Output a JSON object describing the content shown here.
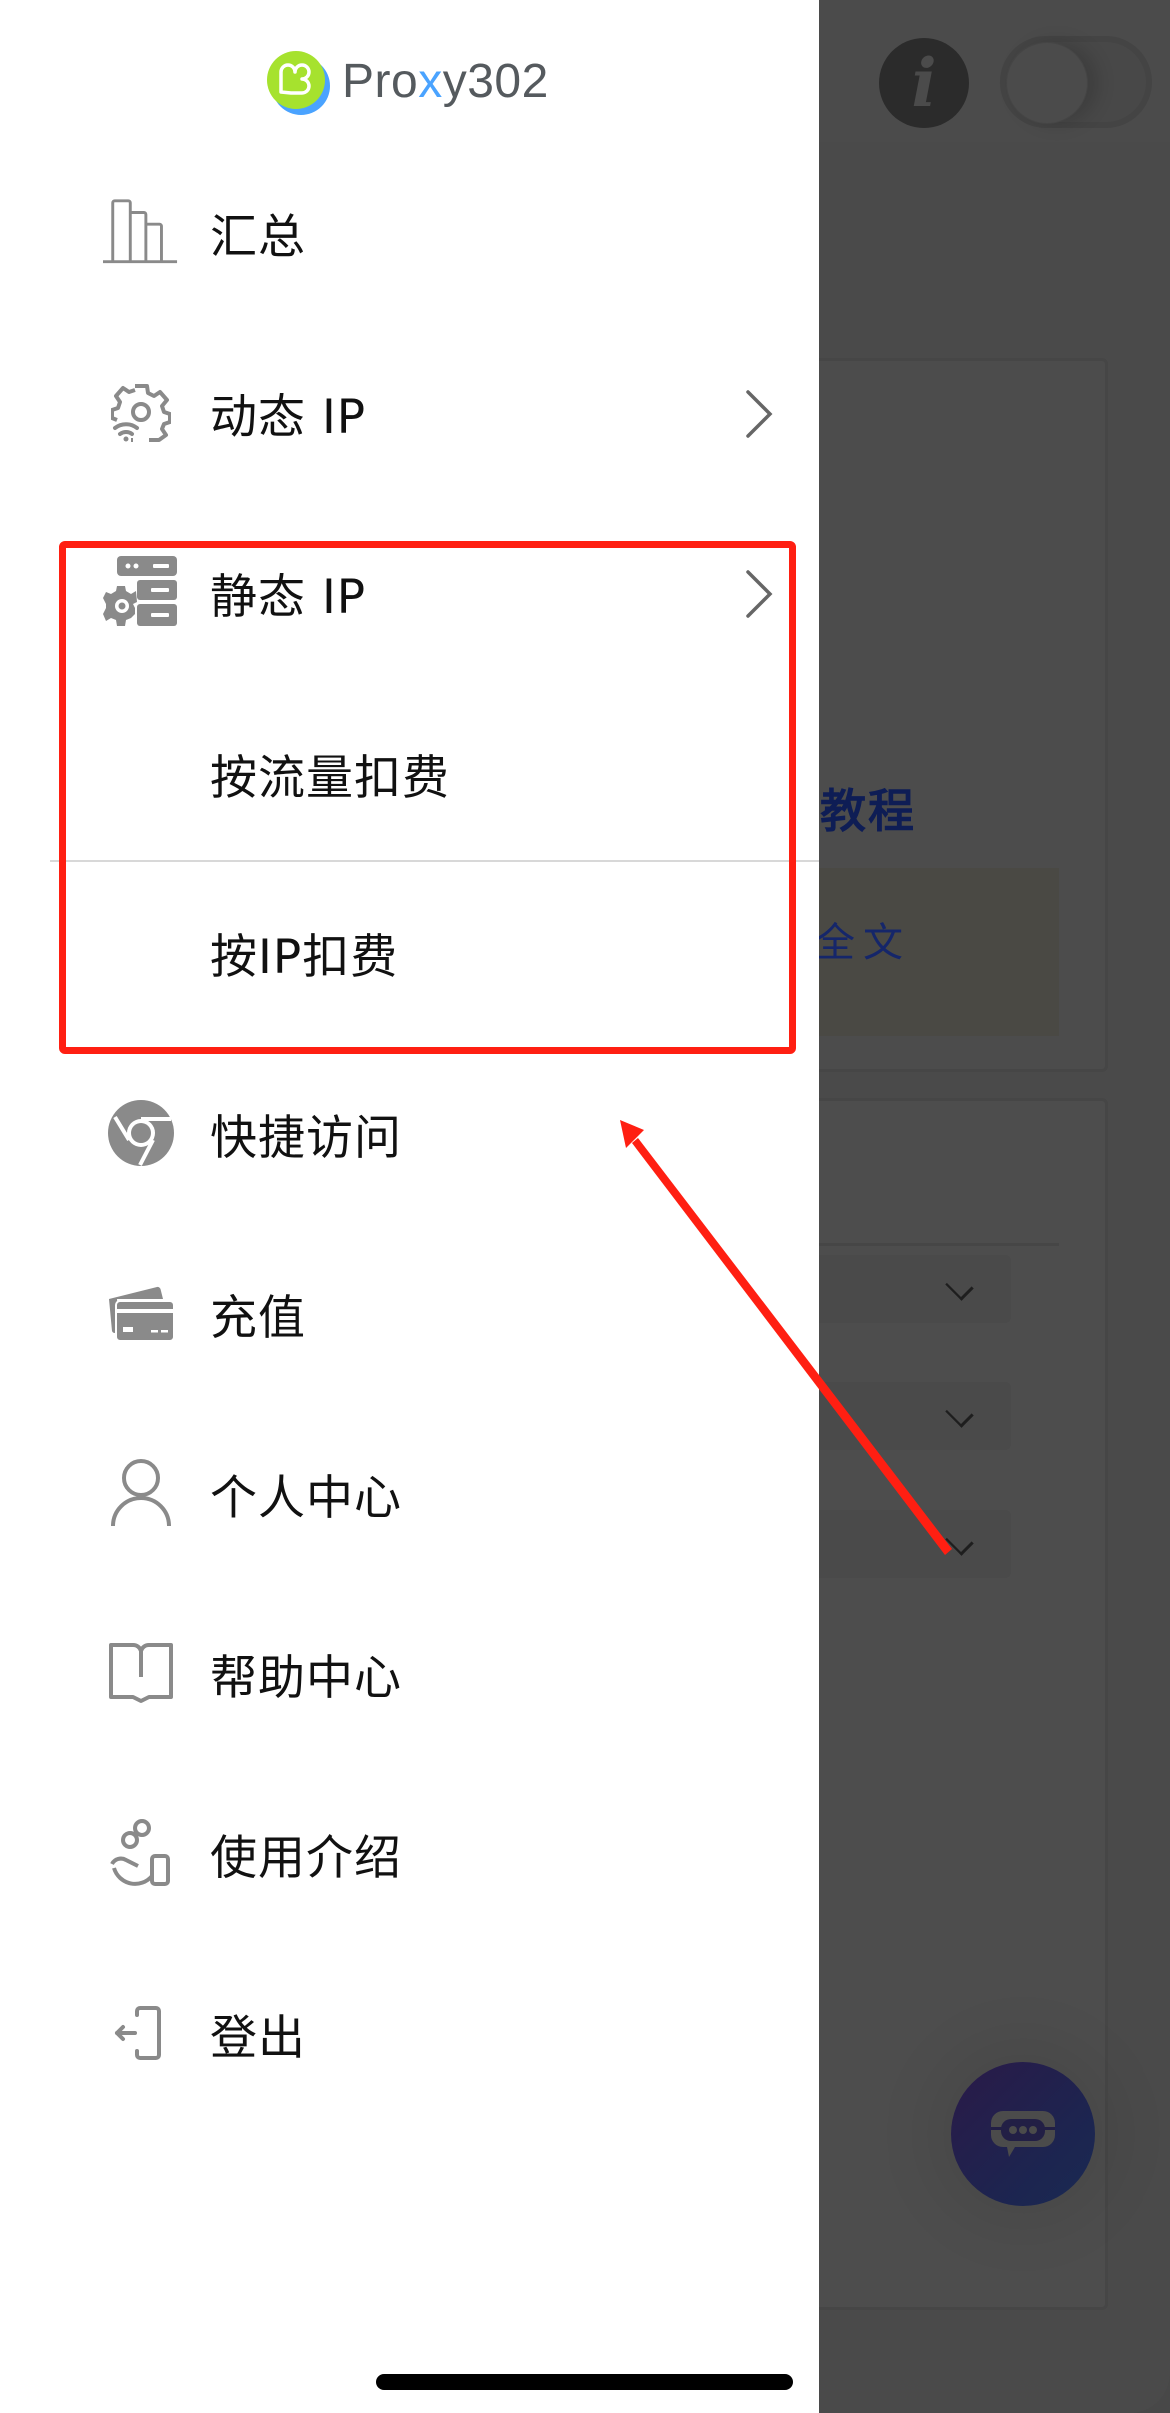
{
  "background_page": {
    "header": {
      "info_icon": "info-icon",
      "toggle_state": "off"
    },
    "card1": {
      "title_partial": "教程",
      "notice_partial": "全文"
    },
    "card2": {
      "select_count": 3
    },
    "chat_button_icon": "chat-bubble-icon"
  },
  "drawer": {
    "logo": {
      "brand_prefix": "Pro",
      "brand_x": "x",
      "brand_suffix": "y302"
    },
    "menu": [
      {
        "label": "汇总",
        "icon": "bar-chart-icon",
        "has_chevron": false
      },
      {
        "label": "动态 IP",
        "icon": "gear-wifi-icon",
        "has_chevron": true
      },
      {
        "label": "静态 IP",
        "icon": "server-gear-icon",
        "has_chevron": true,
        "expanded": true,
        "children": [
          {
            "label": "按流量扣费"
          },
          {
            "label": "按IP扣费"
          }
        ]
      },
      {
        "label": "快捷访问",
        "icon": "chrome-icon",
        "has_chevron": false
      },
      {
        "label": "充值",
        "icon": "credit-card-icon",
        "has_chevron": false
      },
      {
        "label": "个人中心",
        "icon": "user-icon",
        "has_chevron": false
      },
      {
        "label": "帮助中心",
        "icon": "book-icon",
        "has_chevron": false
      },
      {
        "label": "使用介绍",
        "icon": "hand-coin-icon",
        "has_chevron": false
      },
      {
        "label": "登出",
        "icon": "logout-icon",
        "has_chevron": false
      }
    ]
  },
  "annotation": {
    "highlight_color": "#ff1f12",
    "highlights": "静态 IP submenu"
  },
  "colors": {
    "icon_gray": "#8a8a8a",
    "text": "#111111",
    "overlay": "#4a4a4a",
    "annotation_red": "#ff1f12",
    "logo_green": "#a6e22e",
    "logo_blue": "#4aa3ff"
  }
}
